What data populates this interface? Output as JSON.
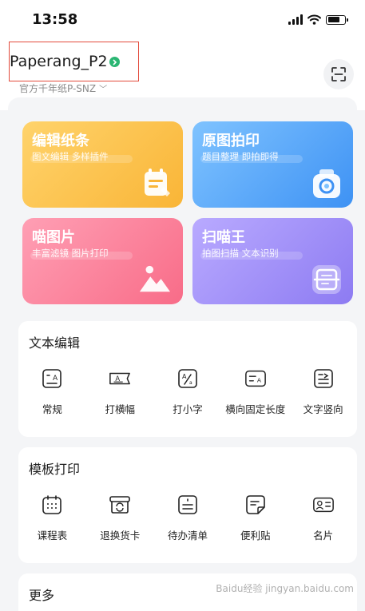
{
  "status_bar": {
    "time": "13:58"
  },
  "device": {
    "name": "Paperang_P2",
    "model": "官方千年纸P-SNZ"
  },
  "feature_cards": [
    {
      "title": "编辑纸条",
      "subtitle": "图文编辑 多样插件",
      "icon": "note-edit-icon"
    },
    {
      "title": "原图拍印",
      "subtitle": "题目整理 即拍即得",
      "icon": "printer-icon"
    },
    {
      "title": "喵图片",
      "subtitle": "丰富滤镜 图片打印",
      "icon": "image-icon"
    },
    {
      "title": "扫喵王",
      "subtitle": "拍图扫描 文本识别",
      "icon": "scan-text-icon"
    }
  ],
  "text_edit": {
    "title": "文本编辑",
    "items": [
      {
        "label": "常规",
        "icon": "text-regular-icon"
      },
      {
        "label": "打横幅",
        "icon": "banner-icon"
      },
      {
        "label": "打小字",
        "icon": "small-text-icon"
      },
      {
        "label": "横向固定长度",
        "icon": "fixed-length-icon"
      },
      {
        "label": "文字竖向",
        "icon": "vertical-text-icon"
      }
    ]
  },
  "template_print": {
    "title": "模板打印",
    "items": [
      {
        "label": "课程表",
        "icon": "timetable-icon"
      },
      {
        "label": "退换货卡",
        "icon": "return-card-icon"
      },
      {
        "label": "待办清单",
        "icon": "todo-list-icon"
      },
      {
        "label": "便利贴",
        "icon": "sticky-note-icon"
      },
      {
        "label": "名片",
        "icon": "business-card-icon"
      }
    ]
  },
  "more": {
    "title": "更多"
  },
  "watermark": "Baidu经验 jingyan.baidu.com",
  "colors": {
    "highlight_box": "#e24a3b",
    "online_dot": "#2bb673",
    "card_yellow": "#f9b537",
    "card_blue": "#3e92f4",
    "card_pink": "#f86c88",
    "card_purple": "#8d7bf2"
  }
}
